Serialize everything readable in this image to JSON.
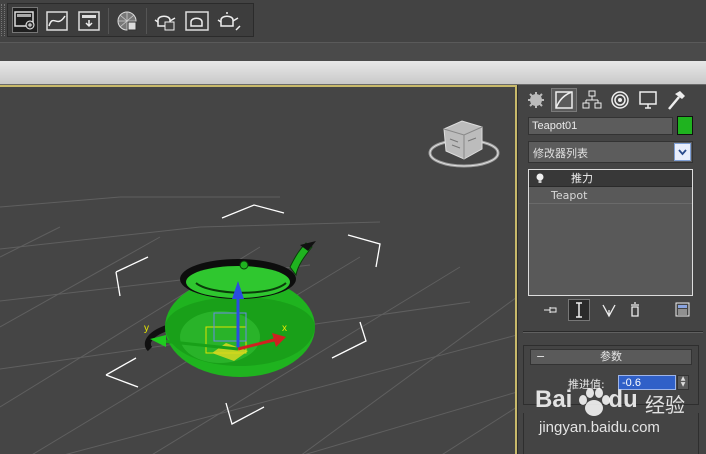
{
  "toolbar": {
    "buttons": [
      {
        "icon": "render-setup-icon",
        "active": true
      },
      {
        "icon": "curve-editor-icon"
      },
      {
        "icon": "schematic-view-icon"
      },
      {
        "icon": "material-editor-icon"
      },
      {
        "icon": "render-frame-icon"
      },
      {
        "icon": "render-production-icon"
      },
      {
        "icon": "render-iterative-icon"
      }
    ]
  },
  "viewport": {
    "axis_x": "x",
    "axis_y": "y",
    "object_color": "#1fb31f"
  },
  "command_panel": {
    "tabs": [
      "create",
      "modify",
      "hierarchy",
      "motion",
      "display",
      "utilities"
    ],
    "active_tab": "modify",
    "object_name": "Teapot01",
    "object_color": "#1fb31f",
    "modifier_list_label": "修改器列表",
    "stack": {
      "selected": "推力",
      "base": "Teapot"
    },
    "rollout": {
      "title": "参数",
      "param_label": "推进值:",
      "param_value": "-0.6"
    }
  },
  "watermark": {
    "logo": "Bai",
    "logo_tail": "du",
    "brand_text": "经验",
    "url": "jingyan.baidu.com"
  }
}
